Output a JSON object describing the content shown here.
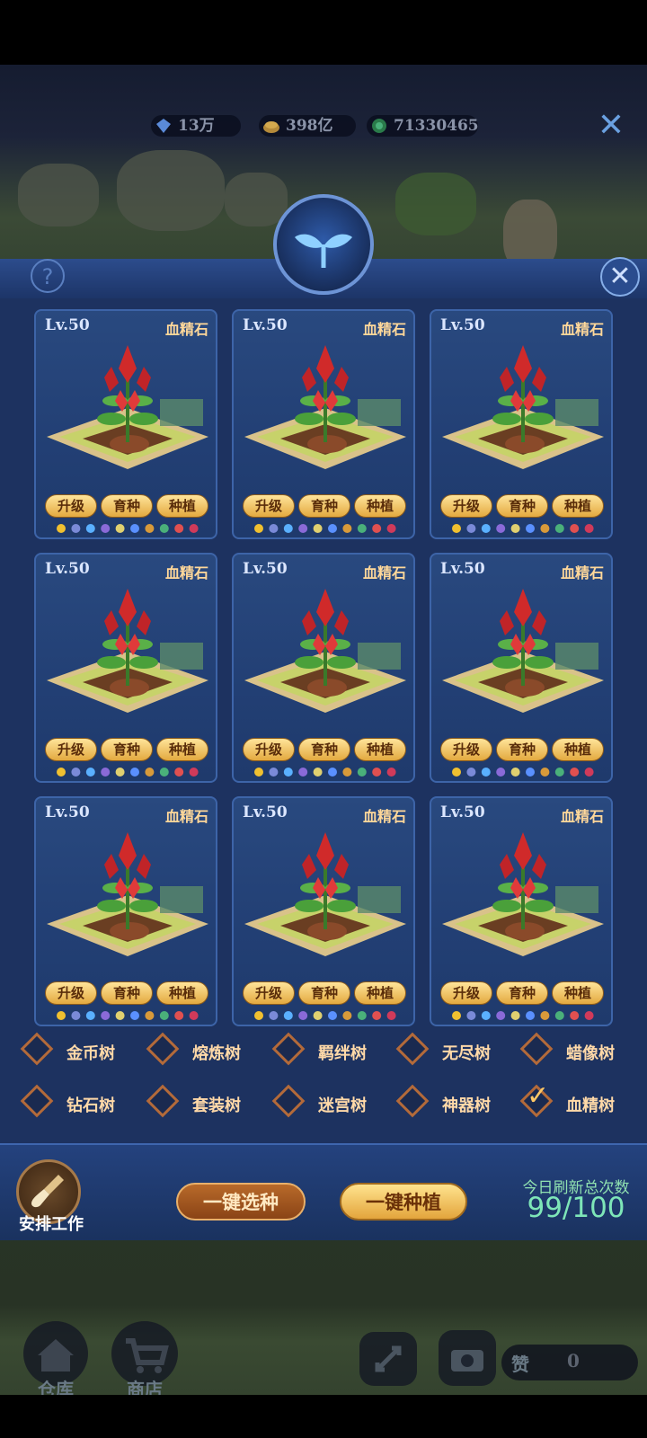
{
  "currency": [
    {
      "icon": "diamond-icon",
      "value": "13万"
    },
    {
      "icon": "gold-coin-icon",
      "value": "398亿"
    },
    {
      "icon": "green-gem-icon",
      "value": "71330465"
    }
  ],
  "panel": {
    "help_symbol": "?",
    "close_symbol": "✕"
  },
  "cards": [
    {
      "level": "Lv.50",
      "type": "血精石",
      "buttons": [
        "升级",
        "育种",
        "种植"
      ]
    },
    {
      "level": "Lv.50",
      "type": "血精石",
      "buttons": [
        "升级",
        "育种",
        "种植"
      ]
    },
    {
      "level": "Lv.50",
      "type": "血精石",
      "buttons": [
        "升级",
        "育种",
        "种植"
      ]
    },
    {
      "level": "Lv.50",
      "type": "血精石",
      "buttons": [
        "升级",
        "育种",
        "种植"
      ]
    },
    {
      "level": "Lv.50",
      "type": "血精石",
      "buttons": [
        "升级",
        "育种",
        "种植"
      ]
    },
    {
      "level": "Lv.50",
      "type": "血精石",
      "buttons": [
        "升级",
        "育种",
        "种植"
      ]
    },
    {
      "level": "Lv.50",
      "type": "血精石",
      "buttons": [
        "升级",
        "育种",
        "种植"
      ]
    },
    {
      "level": "Lv.50",
      "type": "血精石",
      "buttons": [
        "升级",
        "育种",
        "种植"
      ]
    },
    {
      "level": "Lv.50",
      "type": "血精石",
      "buttons": [
        "升级",
        "育种",
        "种植"
      ]
    }
  ],
  "tree_filters": [
    {
      "label": "金币树",
      "checked": false
    },
    {
      "label": "熔炼树",
      "checked": false
    },
    {
      "label": "羁绊树",
      "checked": false
    },
    {
      "label": "无尽树",
      "checked": false
    },
    {
      "label": "蜡像树",
      "checked": false
    },
    {
      "label": "钻石树",
      "checked": false
    },
    {
      "label": "套装树",
      "checked": false
    },
    {
      "label": "迷宫树",
      "checked": false
    },
    {
      "label": "神器树",
      "checked": false
    },
    {
      "label": "血精树",
      "checked": true
    }
  ],
  "footer": {
    "work_label": "安排工作",
    "select_button": "一键选种",
    "plant_button": "一键种植",
    "refresh_label": "今日刷新总次数",
    "refresh_count": "99/100"
  },
  "hud": {
    "warehouse": "仓库",
    "shop": "商店",
    "like_label": "赞",
    "like_count": "0"
  },
  "colors": {
    "panel": "#1d3260",
    "card": "#223f74",
    "button_gold": "#e3a93f",
    "refresh_green": "#7ee6b8"
  }
}
